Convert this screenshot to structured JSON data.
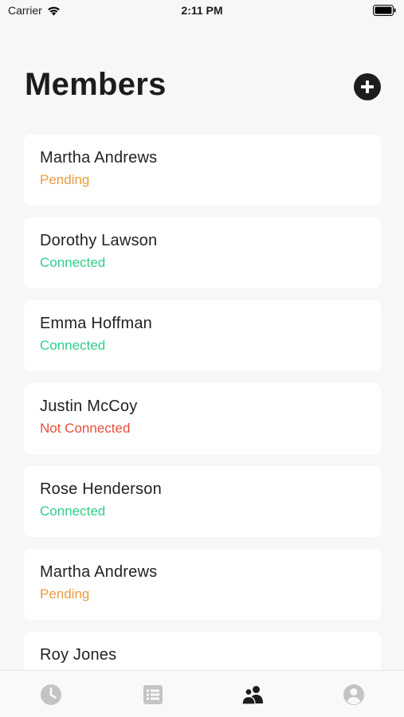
{
  "status_bar": {
    "carrier": "Carrier",
    "time": "2:11 PM"
  },
  "header": {
    "title": "Members"
  },
  "members": [
    {
      "name": "Martha Andrews",
      "status": "Pending"
    },
    {
      "name": "Dorothy Lawson",
      "status": "Connected"
    },
    {
      "name": "Emma Hoffman",
      "status": "Connected"
    },
    {
      "name": "Justin McCoy",
      "status": "Not Connected"
    },
    {
      "name": "Rose Henderson",
      "status": "Connected"
    },
    {
      "name": "Martha Andrews",
      "status": "Pending"
    },
    {
      "name": "Roy Jones",
      "status": ""
    }
  ],
  "tabbar": {
    "tabs": [
      {
        "icon": "clock-icon",
        "active": false
      },
      {
        "icon": "list-icon",
        "active": false
      },
      {
        "icon": "members-icon",
        "active": true
      },
      {
        "icon": "profile-icon",
        "active": false
      }
    ]
  },
  "colors": {
    "pending": "#eb9a3c",
    "connected": "#2ecf8a",
    "not_connected": "#ea4e3d",
    "active_tab": "#1d1d1d",
    "inactive_tab": "#c4c4c4"
  }
}
